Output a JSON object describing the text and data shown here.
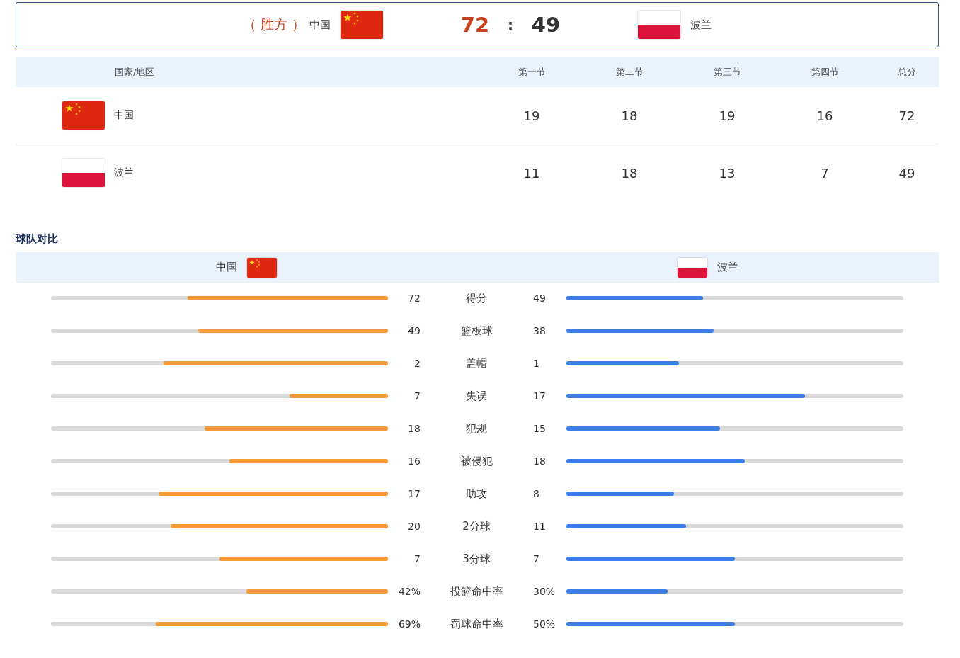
{
  "match": {
    "winner_label": "（ 胜方 ）",
    "home": {
      "name": "中国",
      "flag": {
        "kind": "china"
      }
    },
    "home_score": "72",
    "separator": ":",
    "away_score": "49",
    "away": {
      "name": "波兰",
      "flag": {
        "kind": "poland"
      }
    }
  },
  "quarters": {
    "columns": [
      "国家/地区",
      "第一节",
      "第二节",
      "第三节",
      "第四节",
      "总分"
    ],
    "rows": [
      {
        "team": "中国",
        "flag": {
          "kind": "china"
        },
        "scores": [
          "19",
          "18",
          "19",
          "16",
          "72"
        ]
      },
      {
        "team": "波兰",
        "flag": {
          "kind": "poland"
        },
        "scores": [
          "11",
          "18",
          "13",
          "7",
          "49"
        ]
      }
    ]
  },
  "comparison": {
    "title": "球队对比",
    "home": {
      "name": "中国",
      "flag": {
        "kind": "china"
      }
    },
    "away": {
      "name": "波兰",
      "flag": {
        "kind": "poland"
      }
    },
    "stats": [
      {
        "label": "得分",
        "home": {
          "value": "72",
          "level": 0.595
        },
        "away": {
          "value": "49",
          "level": 0.405
        }
      },
      {
        "label": "篮板球",
        "home": {
          "value": "49",
          "level": 0.563
        },
        "away": {
          "value": "38",
          "level": 0.437
        }
      },
      {
        "label": "盖帽",
        "home": {
          "value": "2",
          "level": 0.667
        },
        "away": {
          "value": "1",
          "level": 0.333
        }
      },
      {
        "label": "失误",
        "home": {
          "value": "7",
          "level": 0.292
        },
        "away": {
          "value": "17",
          "level": 0.708
        }
      },
      {
        "label": "犯规",
        "home": {
          "value": "18",
          "level": 0.545
        },
        "away": {
          "value": "15",
          "level": 0.455
        }
      },
      {
        "label": "被侵犯",
        "home": {
          "value": "16",
          "level": 0.471
        },
        "away": {
          "value": "18",
          "level": 0.529
        }
      },
      {
        "label": "助攻",
        "home": {
          "value": "17",
          "level": 0.68
        },
        "away": {
          "value": "8",
          "level": 0.32
        }
      },
      {
        "label": "2分球",
        "home": {
          "value": "20",
          "level": 0.645
        },
        "away": {
          "value": "11",
          "level": 0.355
        }
      },
      {
        "label": "3分球",
        "home": {
          "value": "7",
          "level": 0.5
        },
        "away": {
          "value": "7",
          "level": 0.5
        }
      },
      {
        "label": "投篮命中率",
        "home": {
          "value": "42%",
          "level": 0.42
        },
        "away": {
          "value": "30%",
          "level": 0.3
        }
      },
      {
        "label": "罚球命中率",
        "home": {
          "value": "69%",
          "level": 0.69
        },
        "away": {
          "value": "50%",
          "level": 0.5
        }
      }
    ]
  }
}
